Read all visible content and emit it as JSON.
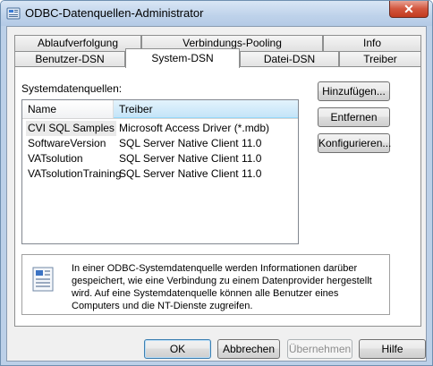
{
  "window": {
    "title": "ODBC-Datenquellen-Administrator"
  },
  "tabs_row1": [
    "Ablaufverfolgung",
    "Verbindungs-Pooling",
    "Info"
  ],
  "tabs_row2": [
    "Benutzer-DSN",
    "System-DSN",
    "Datei-DSN",
    "Treiber"
  ],
  "active_tab": "System-DSN",
  "panel": {
    "section_label": "Systemdatenquellen:",
    "columns": {
      "name": "Name",
      "driver": "Treiber"
    },
    "rows": [
      {
        "name": "CVI SQL Samples",
        "driver": "Microsoft Access Driver (*.mdb)"
      },
      {
        "name": "SoftwareVersion",
        "driver": "SQL Server Native Client 11.0"
      },
      {
        "name": "VATsolution",
        "driver": "SQL Server Native Client 11.0"
      },
      {
        "name": "VATsolutionTraining",
        "driver": "SQL Server Native Client 11.0"
      }
    ],
    "buttons": {
      "add": "Hinzufügen...",
      "remove": "Entfernen",
      "configure": "Konfigurieren..."
    },
    "info_text": "In einer ODBC-Systemdatenquelle werden Informationen darüber gespeichert, wie eine Verbindung zu einem Datenprovider hergestellt wird. Auf eine Systemdatenquelle können alle Benutzer eines Computers und die NT-Dienste zugreifen."
  },
  "footer": {
    "ok": "OK",
    "cancel": "Abbrechen",
    "apply": "Übernehmen",
    "help": "Hilfe"
  },
  "icons": {
    "app": "odbc-admin-icon",
    "close": "close-icon",
    "info": "database-info-icon"
  }
}
